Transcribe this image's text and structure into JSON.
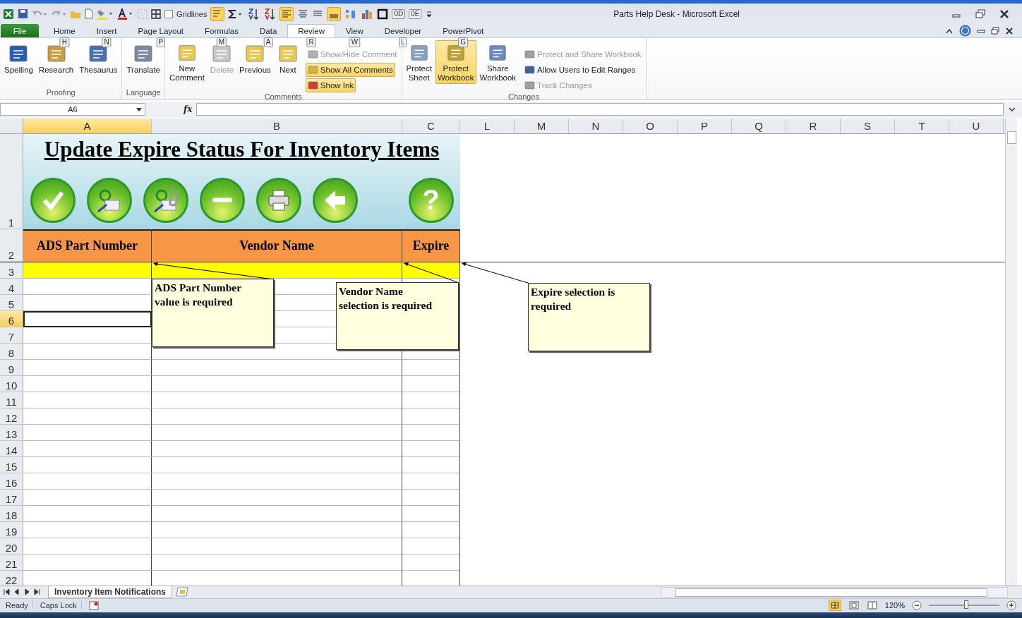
{
  "window": {
    "title": "Parts Help Desk  -  Microsoft Excel"
  },
  "quick_access": {
    "gridlines_label": "Gridlines",
    "gridlines_checked": false,
    "keytips": [
      "0D",
      "0E"
    ]
  },
  "tabs": [
    {
      "label": "File",
      "kind": "file",
      "selected": false
    },
    {
      "label": "Home",
      "keytip": "H",
      "kind": "tab",
      "selected": false
    },
    {
      "label": "Insert",
      "keytip": "N",
      "kind": "tab",
      "selected": false
    },
    {
      "label": "Page Layout",
      "keytip": "P",
      "kind": "tab",
      "selected": false
    },
    {
      "label": "Formulas",
      "keytip": "M",
      "kind": "tab",
      "selected": false
    },
    {
      "label": "Data",
      "keytip": "A",
      "kind": "tab",
      "selected": false
    },
    {
      "label": "Review",
      "keytip": "R",
      "kind": "tab",
      "selected": true
    },
    {
      "label": "View",
      "keytip": "W",
      "kind": "tab",
      "selected": false
    },
    {
      "label": "Developer",
      "keytip": "L",
      "kind": "tab",
      "selected": false
    },
    {
      "label": "PowerPivot",
      "keytip": "G",
      "kind": "tab",
      "selected": false
    }
  ],
  "ribbon_groups": [
    {
      "label": "Proofing",
      "buttons": [
        {
          "lines": [
            "Spelling"
          ],
          "kind": "large",
          "disabled": false,
          "highlighted": false
        },
        {
          "lines": [
            "Research"
          ],
          "kind": "large",
          "disabled": false,
          "highlighted": false
        },
        {
          "lines": [
            "Thesaurus"
          ],
          "kind": "large",
          "disabled": false,
          "highlighted": false
        }
      ]
    },
    {
      "label": "Language",
      "buttons": [
        {
          "lines": [
            "Translate"
          ],
          "kind": "large",
          "disabled": false,
          "highlighted": false
        }
      ]
    },
    {
      "label": "Comments",
      "buttons": [
        {
          "lines": [
            "New",
            "Comment"
          ],
          "kind": "large",
          "disabled": false,
          "highlighted": false
        },
        {
          "lines": [
            "Delete"
          ],
          "kind": "large",
          "disabled": true,
          "highlighted": false
        },
        {
          "lines": [
            "Previous"
          ],
          "kind": "large",
          "disabled": false,
          "highlighted": false
        },
        {
          "lines": [
            "Next"
          ],
          "kind": "large",
          "disabled": false,
          "highlighted": false
        },
        {
          "lines": [
            "Show/Hide Comment"
          ],
          "kind": "small",
          "disabled": true,
          "highlighted": false
        },
        {
          "lines": [
            "Show All Comments"
          ],
          "kind": "small",
          "disabled": false,
          "highlighted": true
        },
        {
          "lines": [
            "Show Ink"
          ],
          "kind": "small",
          "disabled": false,
          "highlighted": true
        }
      ]
    },
    {
      "label": "Changes",
      "buttons": [
        {
          "lines": [
            "Protect",
            "Sheet"
          ],
          "kind": "large",
          "disabled": false,
          "highlighted": false
        },
        {
          "lines": [
            "Protect",
            "Workbook"
          ],
          "kind": "large",
          "disabled": false,
          "highlighted": true
        },
        {
          "lines": [
            "Share",
            "Workbook"
          ],
          "kind": "large",
          "disabled": false,
          "highlighted": false
        },
        {
          "lines": [
            "Protect and Share Workbook"
          ],
          "kind": "small",
          "disabled": true,
          "highlighted": false
        },
        {
          "lines": [
            "Allow Users to Edit Ranges"
          ],
          "kind": "small",
          "disabled": false,
          "highlighted": false
        },
        {
          "lines": [
            "Track Changes"
          ],
          "kind": "small",
          "disabled": true,
          "highlighted": false
        }
      ]
    }
  ],
  "formula_bar": {
    "name_box": "A6",
    "function_label": "fx"
  },
  "columns": [
    {
      "label": "A",
      "selected": true
    },
    {
      "label": "B",
      "selected": false
    },
    {
      "label": "C",
      "selected": false
    },
    {
      "label": "L",
      "selected": false
    },
    {
      "label": "M",
      "selected": false
    },
    {
      "label": "N",
      "selected": false
    },
    {
      "label": "O",
      "selected": false
    },
    {
      "label": "P",
      "selected": false
    },
    {
      "label": "Q",
      "selected": false
    },
    {
      "label": "R",
      "selected": false
    },
    {
      "label": "S",
      "selected": false
    },
    {
      "label": "T",
      "selected": false
    },
    {
      "label": "U",
      "selected": false
    }
  ],
  "rows": [
    {
      "label": "1",
      "selected": false
    },
    {
      "label": "2",
      "selected": false
    },
    {
      "label": "3",
      "selected": false
    },
    {
      "label": "4",
      "selected": false
    },
    {
      "label": "5",
      "selected": false
    },
    {
      "label": "6",
      "selected": true
    },
    {
      "label": "7",
      "selected": false
    },
    {
      "label": "8",
      "selected": false
    },
    {
      "label": "9",
      "selected": false
    },
    {
      "label": "10",
      "selected": false
    },
    {
      "label": "11",
      "selected": false
    },
    {
      "label": "12",
      "selected": false
    },
    {
      "label": "13",
      "selected": false
    },
    {
      "label": "14",
      "selected": false
    },
    {
      "label": "15",
      "selected": false
    },
    {
      "label": "16",
      "selected": false
    },
    {
      "label": "17",
      "selected": false
    },
    {
      "label": "18",
      "selected": false
    },
    {
      "label": "19",
      "selected": false
    },
    {
      "label": "20",
      "selected": false
    },
    {
      "label": "21",
      "selected": false
    },
    {
      "label": "22",
      "selected": false
    }
  ],
  "sheet": {
    "title": "Update Expire Status For Inventory Items",
    "action_buttons": [
      {
        "kind": "check"
      },
      {
        "kind": "email"
      },
      {
        "kind": "attach"
      },
      {
        "kind": "minus"
      },
      {
        "kind": "print"
      },
      {
        "kind": "back"
      },
      {
        "kind": "help",
        "symbol": "?"
      }
    ],
    "headers": [
      "ADS Part Number",
      "Vendor Name",
      "Expire"
    ],
    "comments": [
      {
        "lines": [
          "ADS Part Number",
          "value is required"
        ]
      },
      {
        "lines": [
          "Vendor Name",
          "selection is required"
        ]
      },
      {
        "lines": [
          "Expire selection is",
          "required"
        ]
      }
    ]
  },
  "sheet_tabs": [
    {
      "label": "Inventory Item Notifications",
      "selected": true
    }
  ],
  "status_bar": {
    "items": [
      "Ready",
      "Caps Lock"
    ],
    "zoom": "120%",
    "zoom_slider": {
      "level": 0.53
    }
  }
}
